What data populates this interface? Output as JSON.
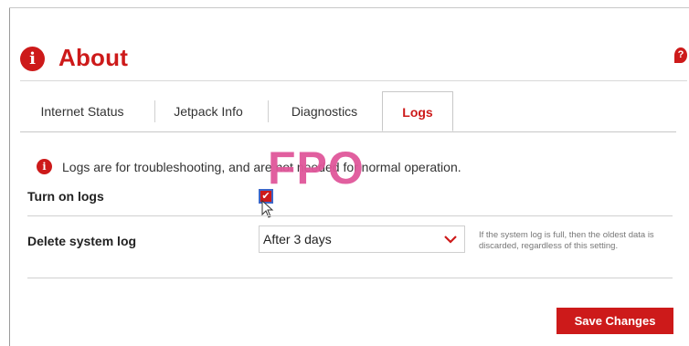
{
  "page": {
    "title": "About",
    "info_icon": "i",
    "help_icon": "?"
  },
  "tabs": [
    {
      "label": "Internet Status",
      "active": false
    },
    {
      "label": "Jetpack Info",
      "active": false
    },
    {
      "label": "Diagnostics",
      "active": false
    },
    {
      "label": "Logs",
      "active": true
    }
  ],
  "notice": {
    "icon": "i",
    "text": "Logs are for troubleshooting, and are not needed for normal operation."
  },
  "overlay_text": "FPO",
  "settings": {
    "turn_on_logs": {
      "label": "Turn on logs",
      "checked": true,
      "check_glyph": "✔"
    },
    "delete_system_log": {
      "label": "Delete system log",
      "selected_value": "After 3 days",
      "helper": "If the system log is full, then the oldest data is discarded, regardless of this setting."
    }
  },
  "actions": {
    "save_label": "Save Changes"
  },
  "colors": {
    "accent": "#cd1a1a",
    "overlay": "#e0579a"
  }
}
